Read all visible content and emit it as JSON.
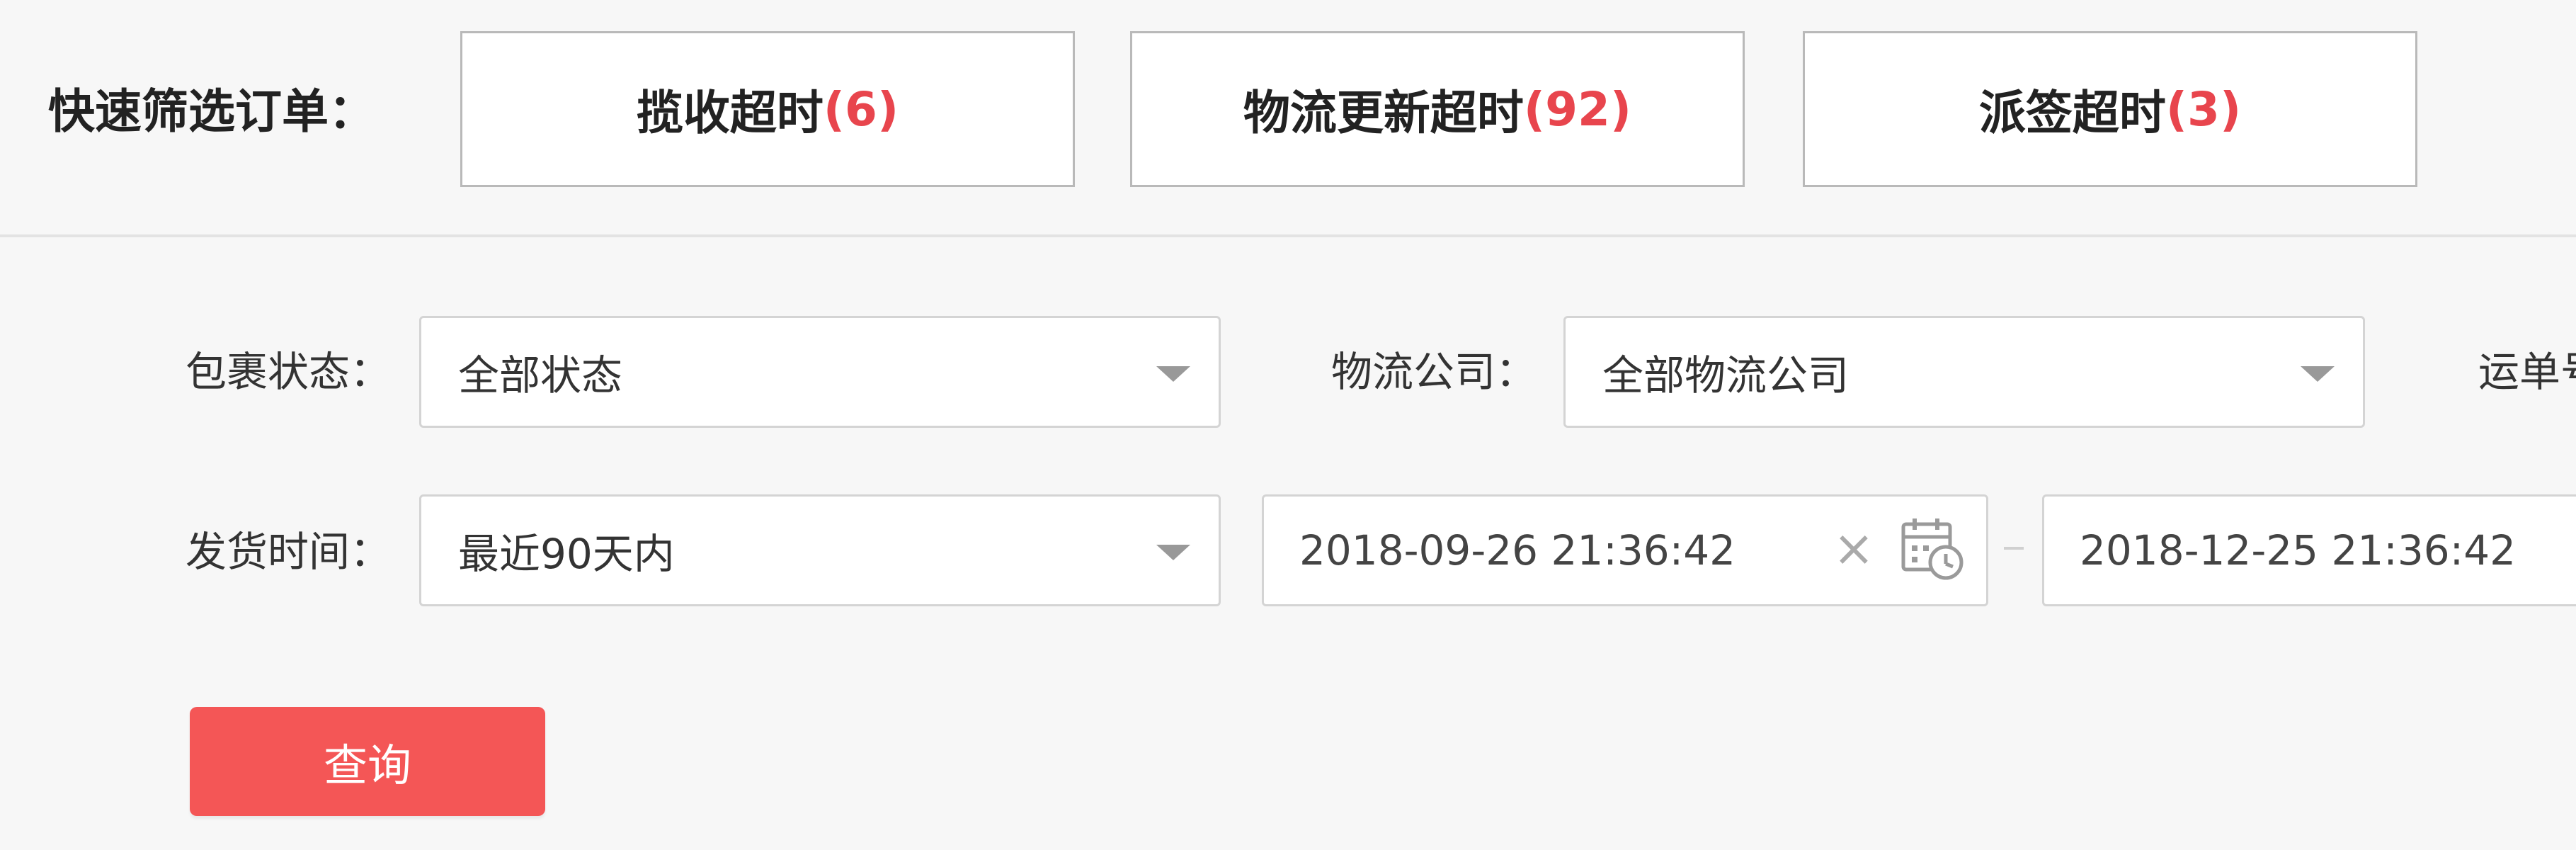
{
  "quick_filter": {
    "label": "快速筛选订单：",
    "buttons": [
      {
        "label": "揽收超时",
        "count": "(6)"
      },
      {
        "label": "物流更新超时",
        "count": "(92)"
      },
      {
        "label": "派签超时",
        "count": "(3)"
      }
    ]
  },
  "form": {
    "package_status": {
      "label": "包裹状态：",
      "value": "全部状态"
    },
    "logistics_company": {
      "label": "物流公司：",
      "value": "全部物流公司"
    },
    "waybill": {
      "label": "运单号"
    },
    "ship_time": {
      "label": "发货时间：",
      "range_value": "最近90天内",
      "start": "2018-09-26 21:36:42",
      "end": "2018-12-25 21:36:42"
    }
  },
  "actions": {
    "query_label": "查询"
  },
  "colors": {
    "accent": "#f45656",
    "count": "#e8454d"
  }
}
